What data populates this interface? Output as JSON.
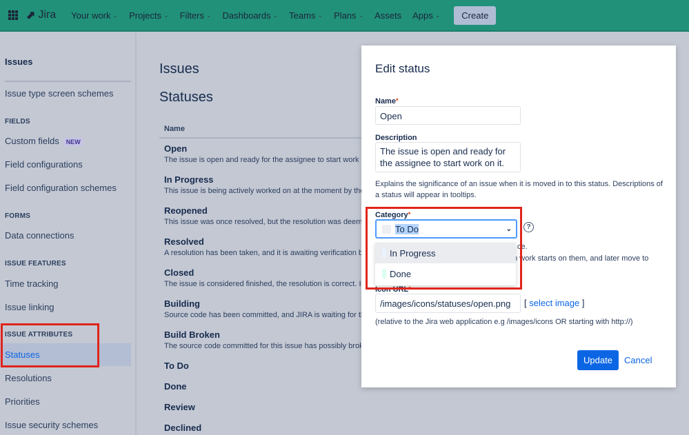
{
  "topbar": {
    "logo": "Jira",
    "nav": [
      "Your work",
      "Projects",
      "Filters",
      "Dashboards",
      "Teams",
      "Plans",
      "Assets",
      "Apps"
    ],
    "nav_has_chevron": [
      true,
      true,
      true,
      true,
      true,
      true,
      false,
      true
    ],
    "create": "Create"
  },
  "sidebar": {
    "top": "Issues",
    "issue_type_screen_schemes": "Issue type screen schemes",
    "fields_head": "FIELDS",
    "custom_fields": "Custom fields",
    "new_badge": "NEW",
    "field_configurations": "Field configurations",
    "field_configuration_schemes": "Field configuration schemes",
    "forms_head": "FORMS",
    "data_connections": "Data connections",
    "issue_features_head": "ISSUE FEATURES",
    "time_tracking": "Time tracking",
    "issue_linking": "Issue linking",
    "issue_attributes_head": "ISSUE ATTRIBUTES",
    "statuses": "Statuses",
    "resolutions": "Resolutions",
    "priorities": "Priorities",
    "issue_security_schemes": "Issue security schemes"
  },
  "main": {
    "title": "Issues",
    "subtitle": "Statuses",
    "col_name": "Name",
    "rows": [
      {
        "name": "Open",
        "desc": "The issue is open and ready for the assignee to start work on it."
      },
      {
        "name": "In Progress",
        "desc": "This issue is being actively worked on at the moment by the assignee."
      },
      {
        "name": "Reopened",
        "desc": "This issue was once resolved, but the resolution was deemed incorrect."
      },
      {
        "name": "Resolved",
        "desc": "A resolution has been taken, and it is awaiting verification by reporter."
      },
      {
        "name": "Closed",
        "desc": "The issue is considered finished, the resolution is correct. Issues"
      },
      {
        "name": "Building",
        "desc": "Source code has been committed, and JIRA is waiting for the code to be built."
      },
      {
        "name": "Build Broken",
        "desc": "The source code committed for this issue has possibly broken the build."
      },
      {
        "name": "To Do",
        "desc": ""
      },
      {
        "name": "Done",
        "desc": ""
      },
      {
        "name": "Review",
        "desc": ""
      },
      {
        "name": "Declined",
        "desc": ""
      }
    ]
  },
  "modal": {
    "title": "Edit status",
    "name_label": "Name",
    "name_value": "Open",
    "description_label": "Description",
    "description_value": "The issue is open and ready for the assignee to start work on it.",
    "description_help": "Explains the significance of an issue when it is moved in to this status. Descriptions of a status will appear in tooltips.",
    "category_label": "Category",
    "category_value": "To Do",
    "category_options": [
      {
        "label": "In Progress",
        "color": "#e9f2ff"
      },
      {
        "label": "Done",
        "color": "#dcfff1"
      }
    ],
    "hidden_help_1": "ce.",
    "hidden_help_2": "en work starts on them, and later move to",
    "icon_url_label": "Icon URL",
    "icon_url_value": "/images/icons/statuses/open.png",
    "select_image_open": "[",
    "select_image": "select image",
    "select_image_close": "]",
    "icon_help": "(relative to the Jira web application e.g /images/icons OR starting with http://)",
    "update": "Update",
    "cancel": "Cancel"
  },
  "colors": {
    "topbar": "#21917a",
    "primary": "#0c66e4",
    "highlight": "#e0241b"
  }
}
